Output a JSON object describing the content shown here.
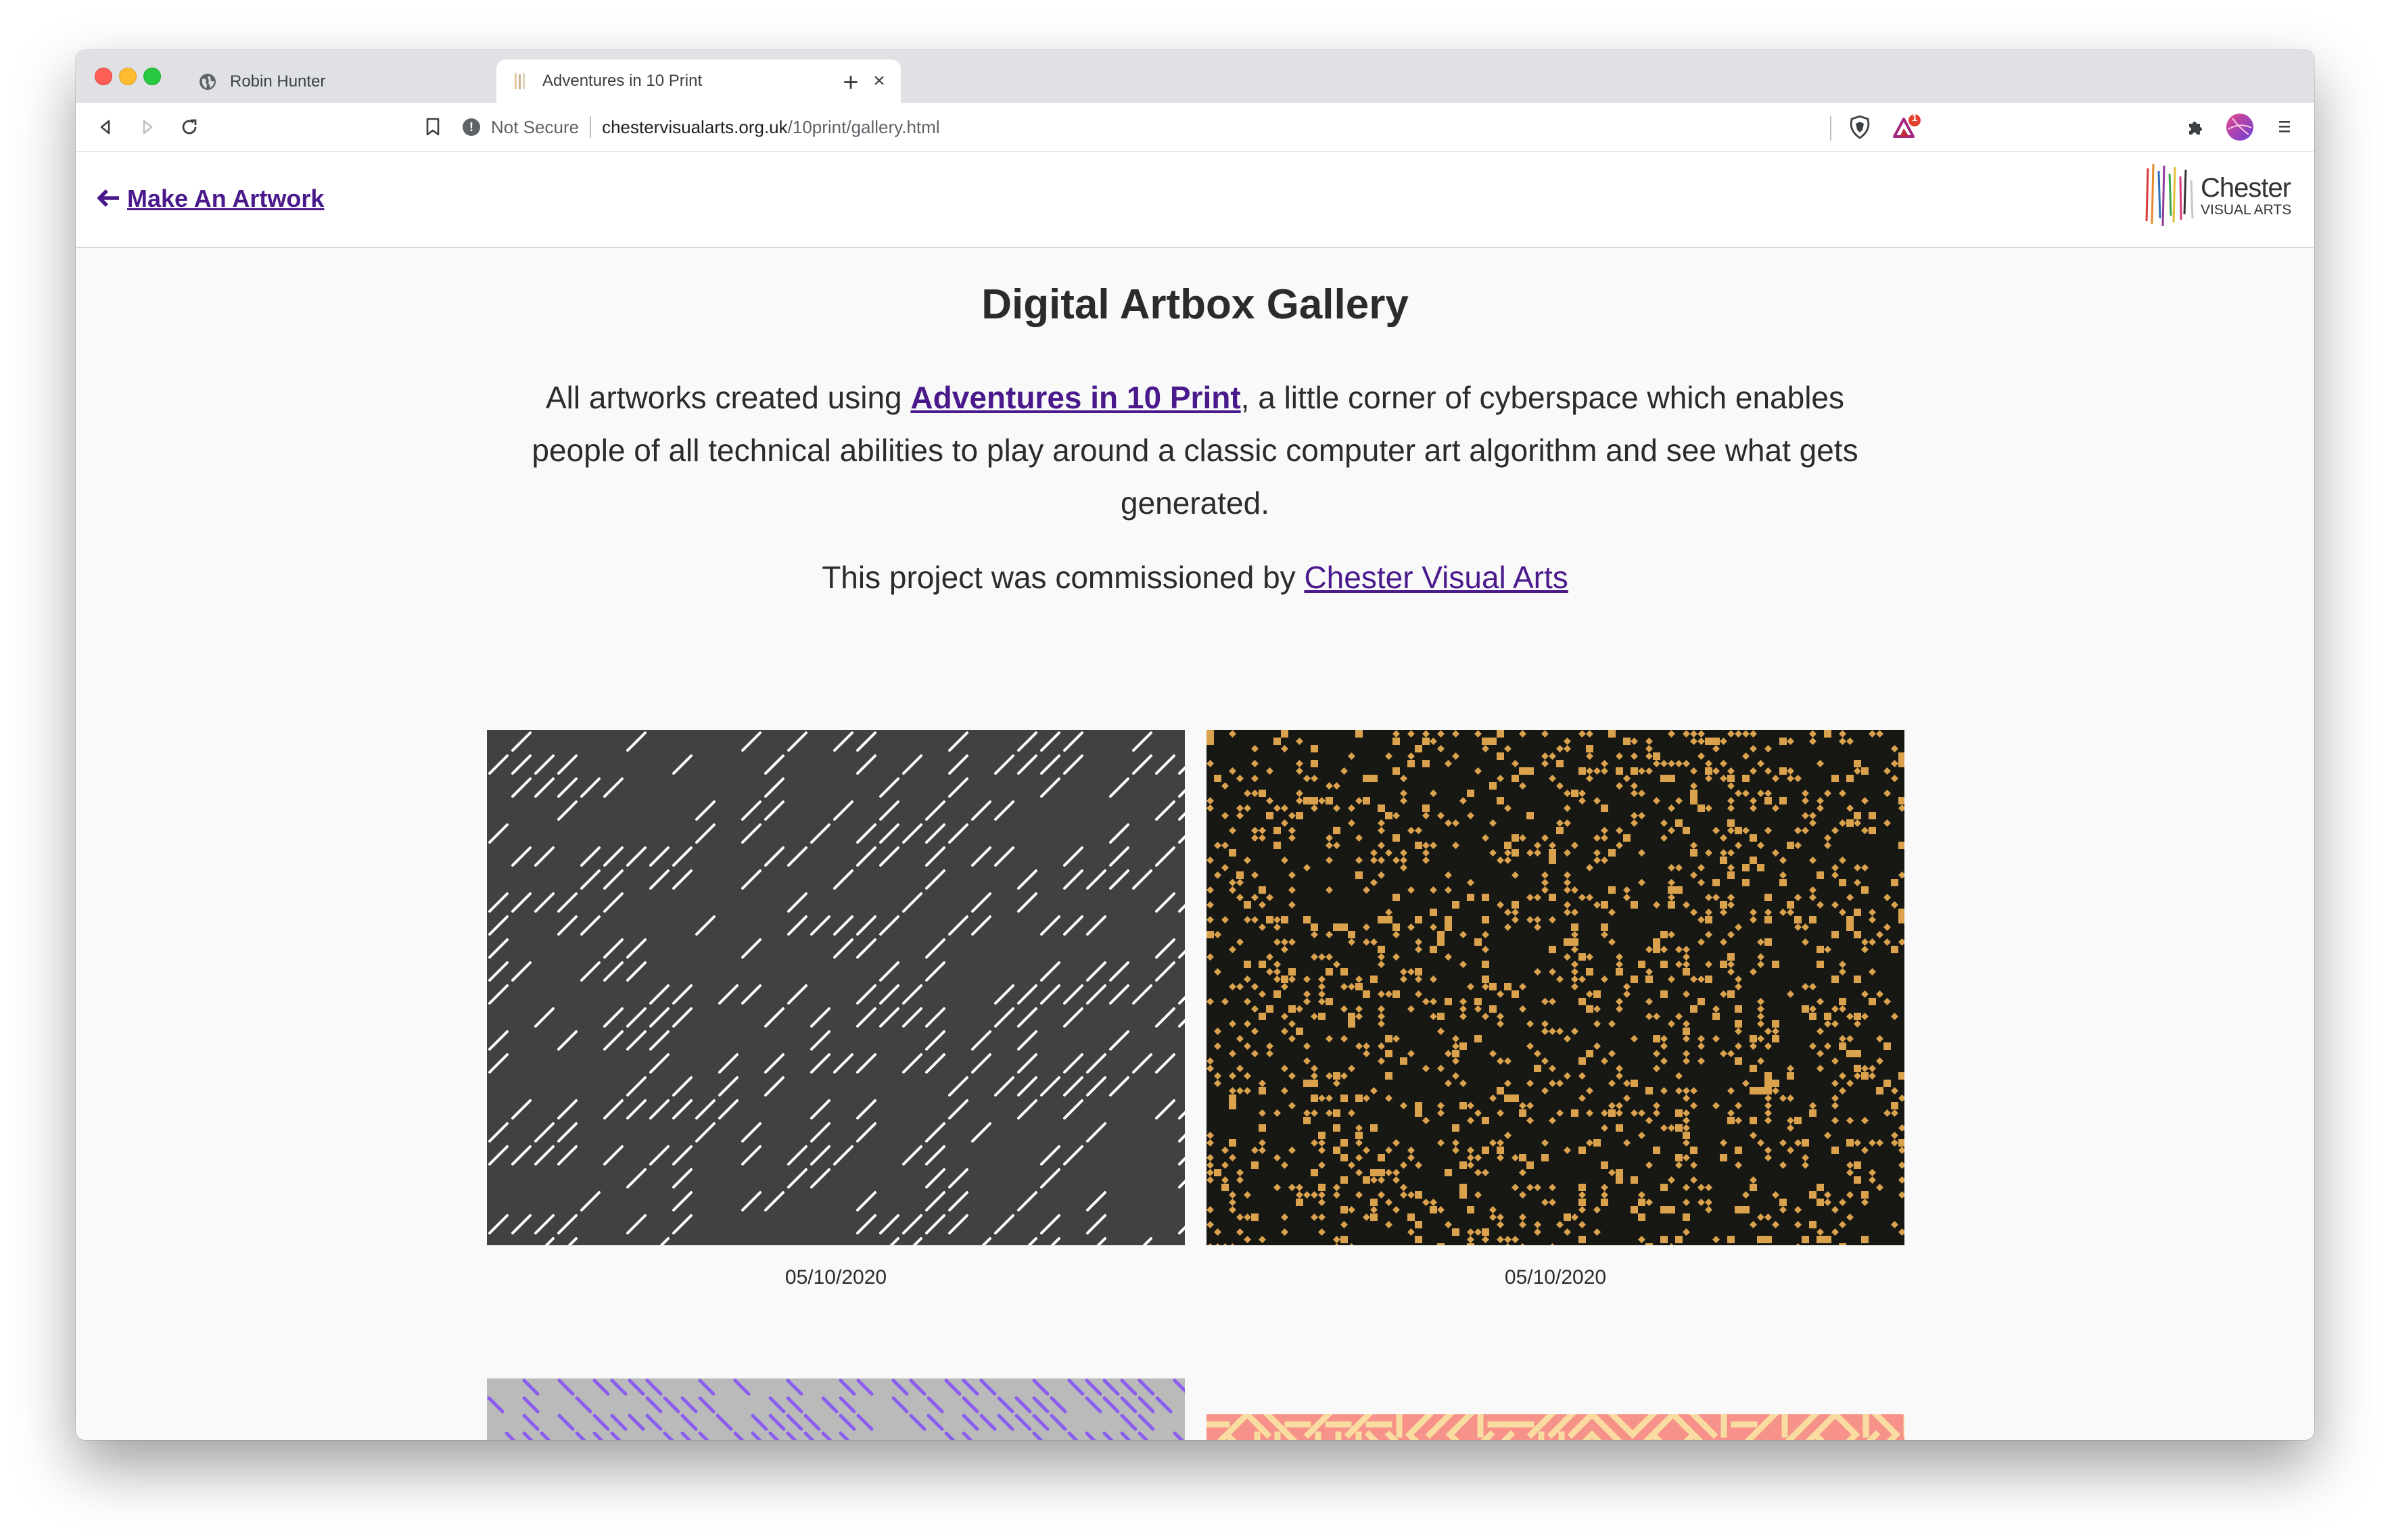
{
  "browser": {
    "tabs": [
      {
        "label": "Robin Hunter",
        "close": "×",
        "active": false
      },
      {
        "label": "Adventures in 10 Print",
        "close": "×",
        "active": true
      }
    ],
    "new_tab": "+",
    "security_label": "Not Secure",
    "url_host": "chestervisualarts.org.uk",
    "url_path": "/10print/gallery.html",
    "alert_count": "1"
  },
  "header": {
    "back_link": "Make An Artwork",
    "logo": {
      "line1": "Chester",
      "line2": "VISUAL ARTS"
    }
  },
  "main": {
    "title": "Digital Artbox Gallery",
    "intro_before": "All artworks created using ",
    "intro_link": "Adventures in 10 Print",
    "intro_after": ", a little corner of cyberspace which enables people of all technical abilities to play around a classic computer art algorithm and see what gets generated.",
    "commission_text": "This project was commissioned by ",
    "commission_link": "Chester Visual Arts"
  },
  "gallery": [
    {
      "date": "05/10/2020",
      "background": "#414141",
      "stroke": "#ffffff",
      "style": "slash-sparse"
    },
    {
      "date": "05/10/2020",
      "background": "#171814",
      "stroke": "#dba24e",
      "style": "dense-blocks"
    },
    {
      "date": "",
      "background": "#bababa",
      "stroke": "#8b5cf0",
      "style": "backslash"
    },
    {
      "date": "",
      "background": "#f6928a",
      "stroke": "#f8dca0",
      "style": "maze"
    }
  ]
}
